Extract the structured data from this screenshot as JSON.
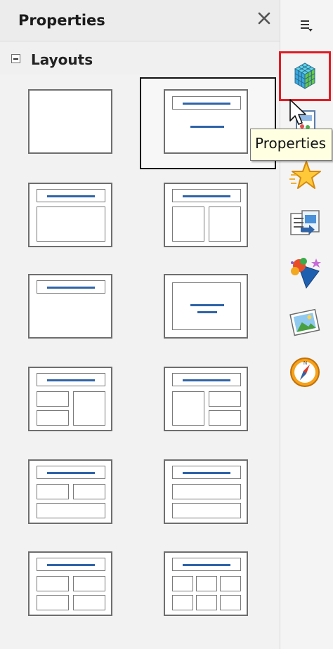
{
  "panel": {
    "title": "Properties",
    "close_icon": "close-icon",
    "section": {
      "title": "Layouts",
      "collapse_icon": "collapse-minus-icon"
    }
  },
  "layouts": [
    "blank-slide",
    "title-only-selected",
    "title-content",
    "title-two-columns",
    "title-only",
    "centered-text",
    "title-two-rows-left-one-right",
    "title-one-left-two-rows-right",
    "title-two-top-one-bottom",
    "title-two-rows",
    "title-four-content",
    "title-six-content"
  ],
  "sidebar": {
    "menu_icon": "sidebar-menu-icon",
    "tabs": [
      {
        "icon": "properties-icon",
        "selected": true
      },
      {
        "icon": "slide-transition-icon"
      },
      {
        "icon": "custom-animation-icon"
      },
      {
        "icon": "master-slides-icon"
      },
      {
        "icon": "styles-icon"
      },
      {
        "icon": "gallery-icon"
      },
      {
        "icon": "navigator-icon"
      }
    ]
  },
  "tooltip": {
    "text": "Properties"
  },
  "colors": {
    "highlight": "#e31b23",
    "layout_line": "#2f64a8",
    "tooltip_bg": "#ffffe1"
  }
}
